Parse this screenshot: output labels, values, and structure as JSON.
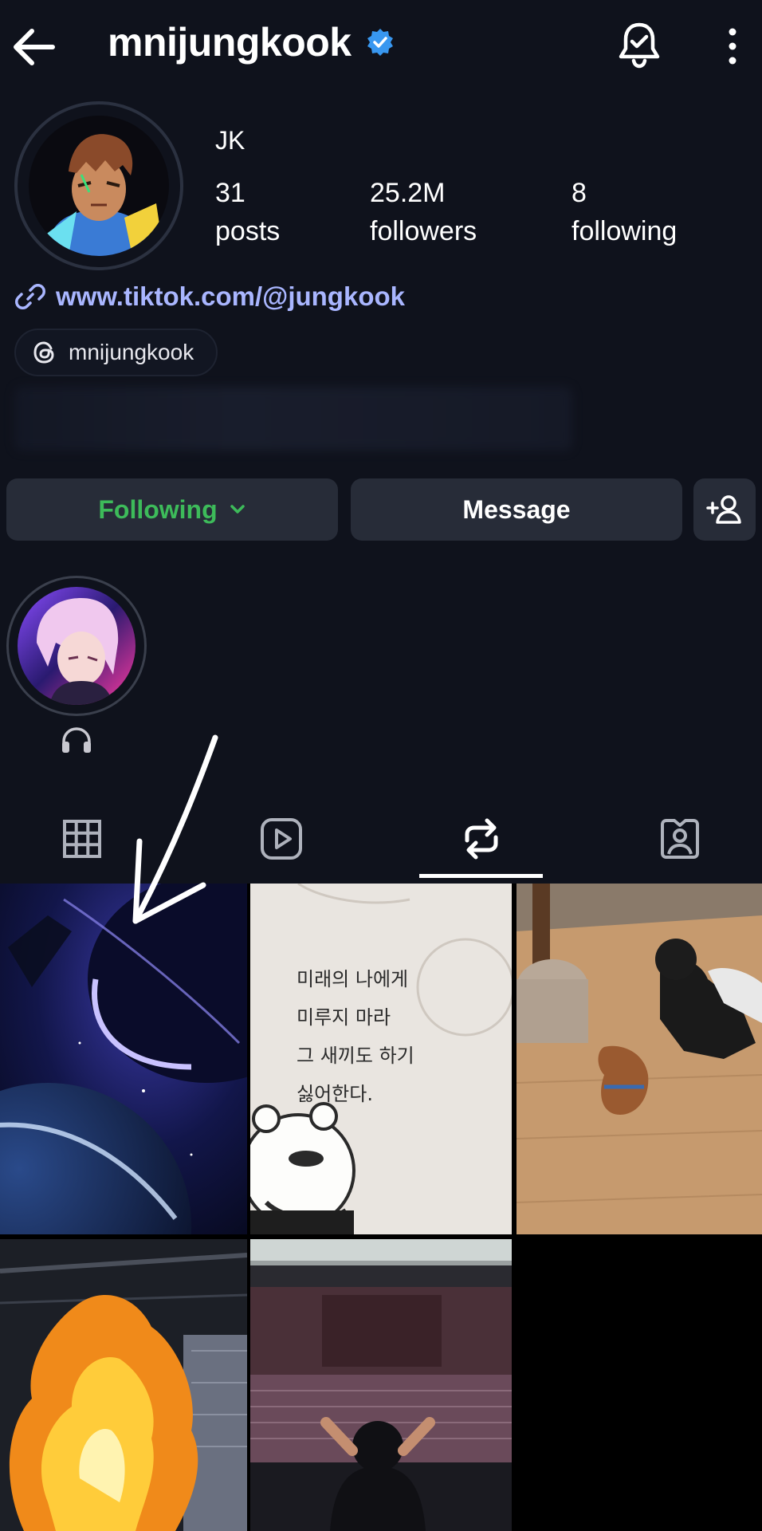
{
  "header": {
    "username": "mnijungkook",
    "icons": {
      "back": "arrow-left-icon",
      "verified": "verified-badge-icon",
      "notifications": "bell-check-icon",
      "more": "more-vertical-icon"
    }
  },
  "profile": {
    "full_name": "JK",
    "stats": [
      {
        "value": "31",
        "label": "posts"
      },
      {
        "value": "25.2M",
        "label": "followers"
      },
      {
        "value": "8",
        "label": "following"
      }
    ],
    "link": "www.tiktok.com/@jungkook",
    "threads_handle": "mnijungkook"
  },
  "actions": {
    "following_label": "Following",
    "message_label": "Message",
    "add_user_icon": "add-user-icon"
  },
  "highlights": [
    {
      "icon": "headphones-icon"
    }
  ],
  "tabs": [
    {
      "icon": "grid-icon",
      "active": false
    },
    {
      "icon": "reels-icon",
      "active": false
    },
    {
      "icon": "reposts-icon",
      "active": true
    },
    {
      "icon": "tagged-icon",
      "active": false
    }
  ],
  "posts": [
    {
      "caption_text": ""
    },
    {
      "caption_text": "미래의 나에게\n미루지 마라\n그 새끼도 하기\n싫어한다."
    },
    {
      "caption_text": ""
    },
    {
      "caption_text": ""
    },
    {
      "caption_text": ""
    }
  ],
  "colors": {
    "background": "#0f121c",
    "link": "#a9b6ff",
    "following_green": "#3dbb5a",
    "button_bg": "#272c38",
    "verified_blue": "#3897f0"
  }
}
